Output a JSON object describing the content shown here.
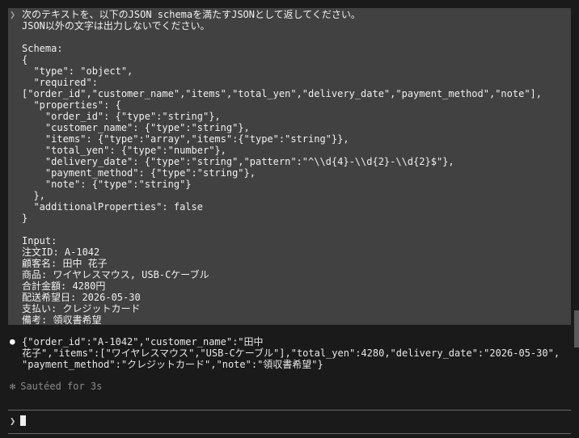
{
  "prompt": {
    "glyph": "❯",
    "text": "次のテキストを、以下のJSON schemaを満たすJSONとして返してください。\nJSON以外の文字は出力しないでください。\n\nSchema:\n{\n  \"type\": \"object\",\n  \"required\":\n[\"order_id\",\"customer_name\",\"items\",\"total_yen\",\"delivery_date\",\"payment_method\",\"note\"],\n  \"properties\": {\n    \"order_id\": {\"type\":\"string\"},\n    \"customer_name\": {\"type\":\"string\"},\n    \"items\": {\"type\":\"array\",\"items\":{\"type\":\"string\"}},\n    \"total_yen\": {\"type\":\"number\"},\n    \"delivery_date\": {\"type\":\"string\",\"pattern\":\"^\\\\d{4}-\\\\d{2}-\\\\d{2}$\"},\n    \"payment_method\": {\"type\":\"string\"},\n    \"note\": {\"type\":\"string\"}\n  },\n  \"additionalProperties\": false\n}\n\nInput:\n注文ID: A-1042\n顧客名: 田中 花子\n商品: ワイヤレスマウス, USB-Cケーブル\n合計金額: 4280円\n配送希望日: 2026-05-30\n支払い: クレジットカード\n備考: 領収書希望"
  },
  "response": {
    "bullet": "●",
    "text": "{\"order_id\":\"A-1042\",\"customer_name\":\"田中\n花子\",\"items\":[\"ワイヤレスマウス\",\"USB-Cケーブル\"],\"total_yen\":4280,\"delivery_date\":\"2026-05-30\",\n\"payment_method\":\"クレジットカード\",\"note\":\"領収書希望\"}"
  },
  "status": {
    "glyph": "✻",
    "text": "Sautéed for 3s"
  },
  "input": {
    "glyph": "❯",
    "value": ""
  }
}
